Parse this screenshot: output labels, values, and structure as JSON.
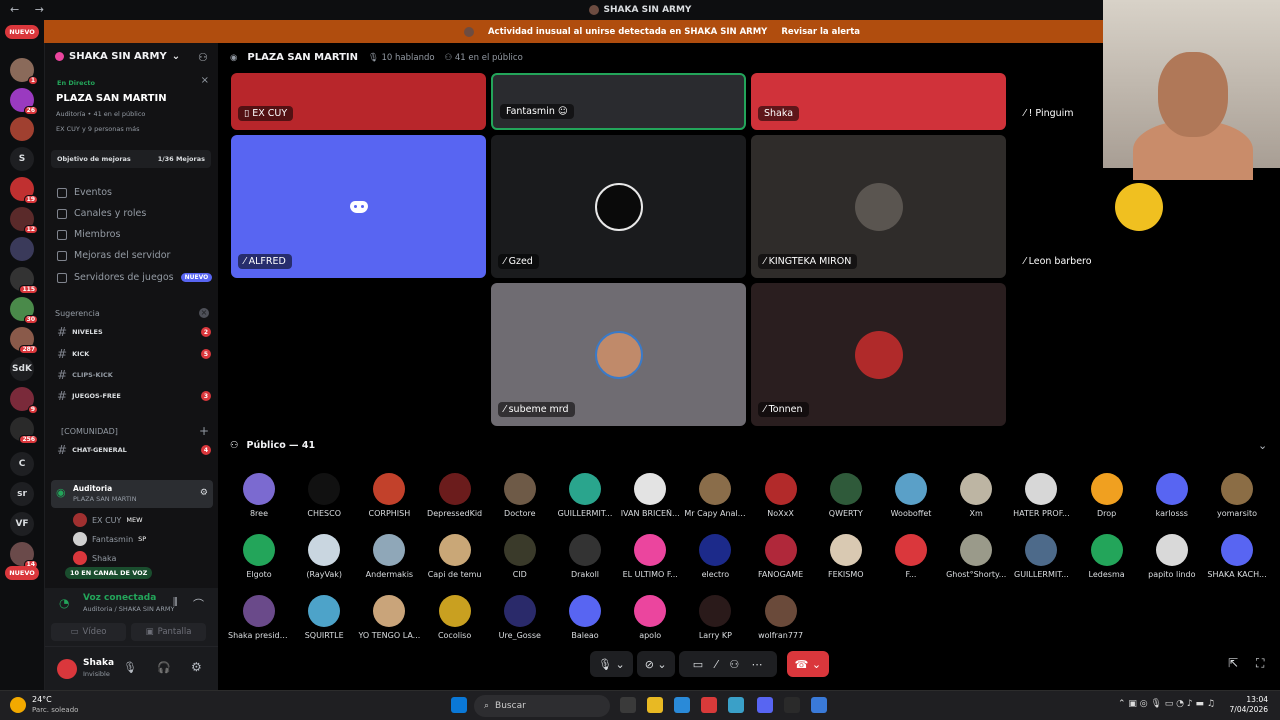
{
  "window": {
    "title": "SHAKA SIN ARMY",
    "nav": "← →"
  },
  "alert": {
    "text": "Actividad inusual al unirse detectada en SHAKA SIN ARMY",
    "link": "Revisar la alerta"
  },
  "rail": {
    "badges": [
      {
        "label": "NUEVO"
      },
      {
        "label": "S"
      },
      {
        "label": "SdK"
      },
      {
        "label": "C"
      },
      {
        "label": "sr"
      },
      {
        "label": "VF"
      },
      {
        "label": "NUEVO"
      }
    ],
    "counts": [
      "1",
      "26",
      "19",
      "12",
      "115",
      "30",
      "287",
      "9",
      "256",
      "14"
    ]
  },
  "sidebar": {
    "server_name": "SHAKA SIN ARMY",
    "stage": {
      "live": "En Directo",
      "title": "PLAZA SAN MARTIN",
      "sub": "Auditoría • 41 en el público",
      "sub2": "EX CUY y 9 personas más"
    },
    "goal": {
      "label": "Objetivo de mejoras",
      "progress": "1/36 Mejoras"
    },
    "nav": [
      {
        "label": "Eventos"
      },
      {
        "label": "Canales y roles"
      },
      {
        "label": "Miembros"
      },
      {
        "label": "Mejoras del servidor"
      },
      {
        "label": "Servidores de juegos",
        "badge": "NUEVO"
      }
    ],
    "suggestion_label": "Sugerencia",
    "channels": [
      {
        "name": "NIVELES",
        "count": "2"
      },
      {
        "name": "KICK",
        "count": "5"
      },
      {
        "name": "CLIPS-KICK",
        "count": ""
      },
      {
        "name": "JUEGOS-FREE",
        "count": "3"
      }
    ],
    "category": "[COMUNIDAD]",
    "chat": {
      "name": "CHAT-GENERAL",
      "count": "4"
    },
    "voice_channel": {
      "name": "Auditoria",
      "sub": "PLAZA SAN MARTIN"
    },
    "voice_users": [
      "EX CUY",
      "Fantasmin",
      "Shaka"
    ],
    "voice_tags": [
      "MEW",
      "SP"
    ],
    "in_voice": "10 EN CANAL DE VOZ",
    "connection": {
      "status": "Voz conectada",
      "detail": "Auditoria / SHAKA SIN ARMY",
      "video": "Vídeo",
      "screen": "Pantalla"
    },
    "user": {
      "name": "Shaka",
      "status": "Invisible"
    }
  },
  "main": {
    "channel": "PLAZA SAN MARTIN",
    "speaking": "10 hablando",
    "audience": "41 en el público",
    "tiles": [
      {
        "name": "EX CUY",
        "color": "#b8262b"
      },
      {
        "name": "Fantasmin",
        "color": "#2a2b2f"
      },
      {
        "name": "Shaka",
        "color": "#d0323a"
      },
      {
        "name": "! Pinguim",
        "color": "#000000"
      },
      {
        "name": "ALFRED",
        "color": "#5865f2"
      },
      {
        "name": "Gzed",
        "color": "#1a1b1d"
      },
      {
        "name": "KINGTEKA MIRON",
        "color": "#2f2c2a"
      },
      {
        "name": "Leon barbero",
        "color": "#000000"
      },
      {
        "name": "subeme mrd",
        "color": "#6f6c72"
      },
      {
        "name": "Tonnen",
        "color": "#2a1e1f"
      }
    ],
    "public_header": "Público — 41",
    "audience_members": [
      {
        "name": "8ree",
        "color": "#7b6ad0"
      },
      {
        "name": "CHESCO",
        "color": "#111111"
      },
      {
        "name": "CORPHISH",
        "color": "#c2412b"
      },
      {
        "name": "DepressedKid",
        "color": "#6b1c1c"
      },
      {
        "name": "Doctore",
        "color": "#6e5a47"
      },
      {
        "name": "GUILLERMIT...",
        "color": "#2aa58d"
      },
      {
        "name": "IVAN BRICEÑ...",
        "color": "#e3e3e3"
      },
      {
        "name": "Mr Capy Anali...",
        "color": "#8a6d4a"
      },
      {
        "name": "NoXxX",
        "color": "#b22a2a"
      },
      {
        "name": "QWERTY",
        "color": "#2f5a3a"
      },
      {
        "name": "Wooboffet",
        "color": "#5aa0c8"
      },
      {
        "name": "Xm",
        "color": "#bdb5a3"
      },
      {
        "name": "HATER PROF...",
        "color": "#d7d7d7"
      },
      {
        "name": "Drop",
        "color": "#f0a020"
      },
      {
        "name": "karlosss",
        "color": "#5865f2"
      },
      {
        "name": "yomarsito",
        "color": "#8b6d45"
      },
      {
        "name": "Elgoto",
        "color": "#23a55a"
      },
      {
        "name": "(RayVak)",
        "color": "#c9d6e0"
      },
      {
        "name": "Andermakis",
        "color": "#8fa7b8"
      },
      {
        "name": "Capi de temu",
        "color": "#c9a777"
      },
      {
        "name": "CID",
        "color": "#3a3a2a"
      },
      {
        "name": "Drakoll",
        "color": "#333333"
      },
      {
        "name": "EL ULTIMO F...",
        "color": "#eb459e"
      },
      {
        "name": "electro",
        "color": "#1c2a8a"
      },
      {
        "name": "FANOGAME",
        "color": "#b0283a"
      },
      {
        "name": "FEKISMO",
        "color": "#d9c9b2"
      },
      {
        "name": "F...",
        "color": "#da373c"
      },
      {
        "name": "Ghost°Shorty...",
        "color": "#9a9a8a"
      },
      {
        "name": "GUILLERMIT...",
        "color": "#4d6a8a"
      },
      {
        "name": "Ledesma",
        "color": "#23a55a"
      },
      {
        "name": "papito lindo",
        "color": "#d9d9d9"
      },
      {
        "name": "SHAKA KACH...",
        "color": "#5865f2"
      },
      {
        "name": "Shaka preside...",
        "color": "#6a4a8a"
      },
      {
        "name": "SQUIRTLE",
        "color": "#4da3c9"
      },
      {
        "name": "YO TENGO LA...",
        "color": "#c9a47a"
      },
      {
        "name": "Cocoliso",
        "color": "#c9a020"
      },
      {
        "name": "Ure_Gosse",
        "color": "#2a2a6a"
      },
      {
        "name": "Baleao",
        "color": "#5865f2"
      },
      {
        "name": "apolo",
        "color": "#eb459e"
      },
      {
        "name": "Larry KP",
        "color": "#2a1a1a"
      },
      {
        "name": "wolfran777",
        "color": "#6a4a3a"
      }
    ]
  },
  "taskbar": {
    "weather_temp": "24°C",
    "weather_desc": "Parc. soleado",
    "search": "Buscar",
    "time": "13:04",
    "date": "7/04/2026"
  }
}
